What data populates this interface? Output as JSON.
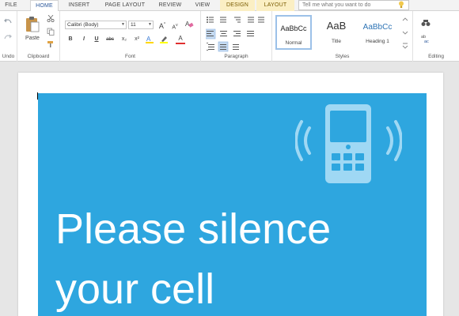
{
  "tabs": [
    {
      "label": "FILE"
    },
    {
      "label": "HOME"
    },
    {
      "label": "INSERT"
    },
    {
      "label": "PAGE LAYOUT"
    },
    {
      "label": "REVIEW"
    },
    {
      "label": "VIEW"
    },
    {
      "label": "DESIGN"
    },
    {
      "label": "LAYOUT"
    }
  ],
  "tell_me": {
    "placeholder": "Tell me what you want to do"
  },
  "ribbon": {
    "groups": {
      "undo": "Undo",
      "clipboard": "Clipboard",
      "font": "Font",
      "paragraph": "Paragraph",
      "styles": "Styles",
      "editing": "Editing"
    },
    "paste_label": "Paste",
    "font_name": "Calibri (Body)",
    "font_size": "11",
    "bold": "B",
    "italic": "I",
    "underline": "U",
    "strike": "abc",
    "subscript": "x₂",
    "superscript": "x²",
    "grow_font": "A",
    "shrink_font": "A",
    "font_color": "A",
    "styles": [
      {
        "sample": "AaBbCc",
        "name": "Normal"
      },
      {
        "sample": "AaB",
        "name": "Title"
      },
      {
        "sample": "AaBbCc",
        "name": "Heading 1"
      }
    ]
  },
  "document": {
    "headline_line1": "Please silence",
    "headline_line2": "your cell",
    "banner_color": "#2ea6df"
  },
  "colors": {
    "accent": "#2b579a",
    "contextual_tab": "#fbefc4"
  }
}
